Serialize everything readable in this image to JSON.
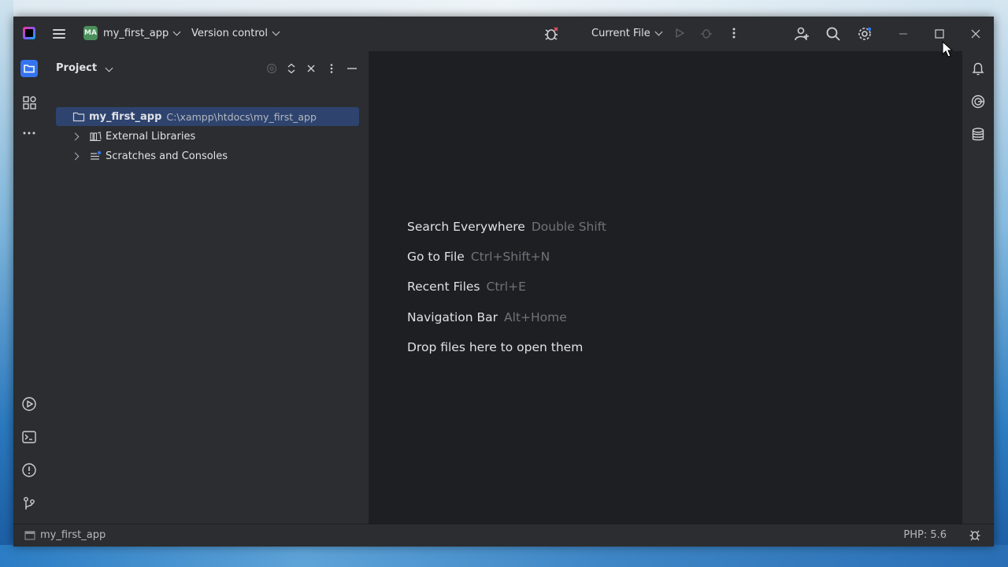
{
  "titlebar": {
    "project_badge": "MA",
    "project_name": "my_first_app",
    "vcs_label": "Version control",
    "run_config": "Current File"
  },
  "project_panel": {
    "title": "Project",
    "tree": [
      {
        "label": "my_first_app",
        "path": "C:\\xampp\\htdocs\\my_first_app",
        "icon": "folder-icon",
        "selected": true
      },
      {
        "label": "External Libraries",
        "icon": "library-icon"
      },
      {
        "label": "Scratches and Consoles",
        "icon": "scratches-icon"
      }
    ]
  },
  "editor": {
    "hints": [
      {
        "label": "Search Everywhere",
        "key": "Double Shift"
      },
      {
        "label": "Go to File",
        "key": "Ctrl+Shift+N"
      },
      {
        "label": "Recent Files",
        "key": "Ctrl+E"
      },
      {
        "label": "Navigation Bar",
        "key": "Alt+Home"
      },
      {
        "label": "Drop files here to open them",
        "key": ""
      }
    ]
  },
  "statusbar": {
    "path": "my_first_app",
    "php": "PHP: 5.6"
  },
  "colors": {
    "accent": "#3574f0",
    "selection": "#2e436e",
    "panel_bg": "#2b2d30",
    "editor_bg": "#1e1f22",
    "badge": "#4b8f5a"
  }
}
